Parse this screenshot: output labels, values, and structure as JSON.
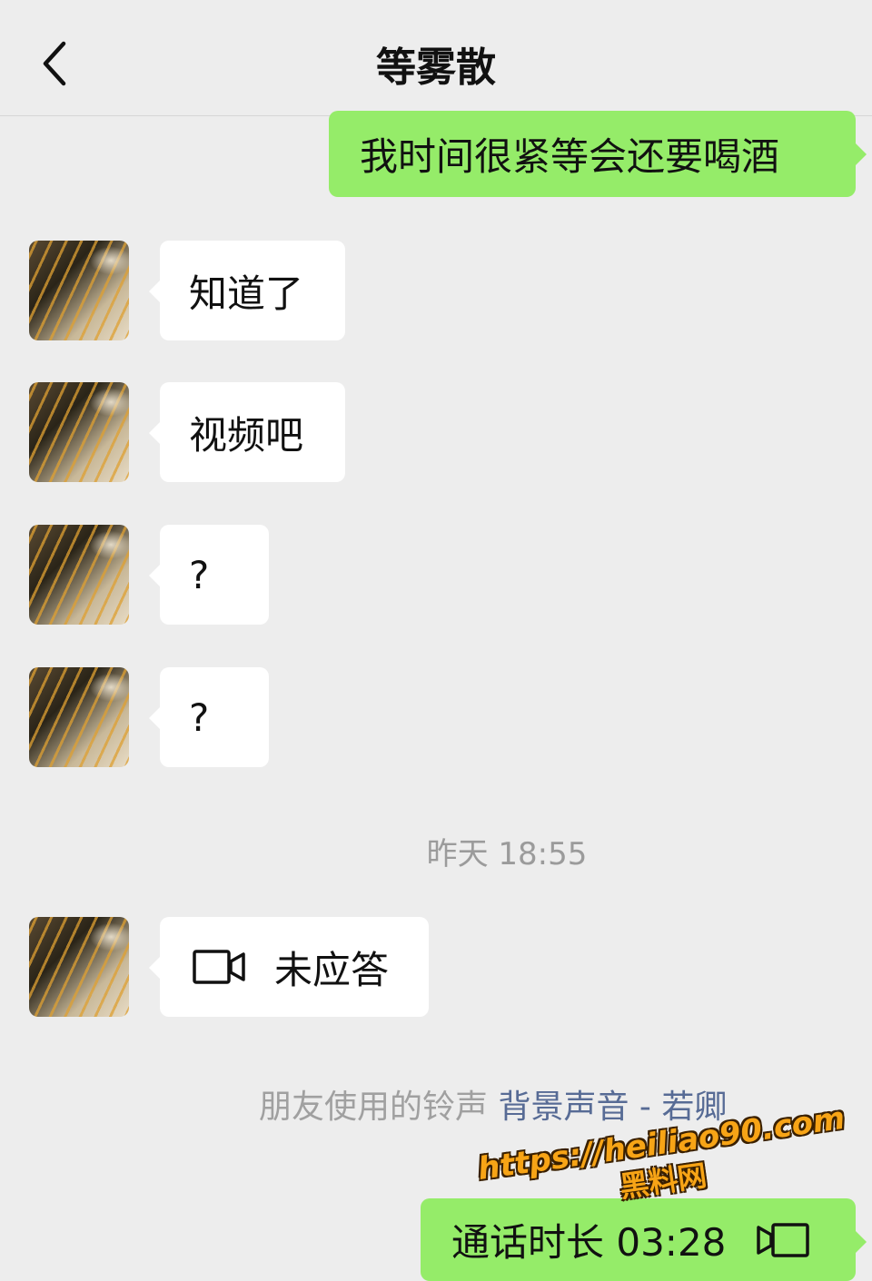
{
  "header": {
    "title": "等雾散",
    "back_icon": "chevron-left-icon"
  },
  "messages": {
    "out_1": "我时间很紧等会还要喝酒",
    "in_1": "知道了",
    "in_2": "视频吧",
    "in_3": "?",
    "in_4": "?",
    "timestamp": "昨天 18:55",
    "call_status": "未应答",
    "ringtone_prefix": "朋友使用的铃声",
    "ringtone_link": "背景声音 - 若卿",
    "out_call": "通话时长 03:28"
  },
  "watermark": {
    "url": "https://heiliao90.com",
    "name": "黑料网"
  },
  "colors": {
    "outgoing_bubble": "#95ec69",
    "incoming_bubble": "#ffffff",
    "link": "#576b95",
    "background": "#ededed"
  }
}
